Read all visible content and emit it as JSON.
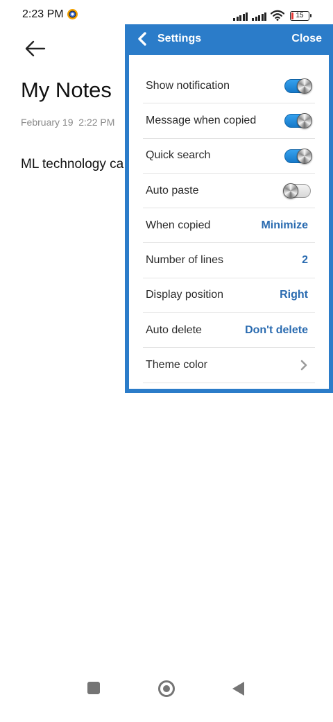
{
  "status_bar": {
    "time": "2:23 PM",
    "battery_level": "15",
    "battery_percent": 15
  },
  "note": {
    "title": "My Notes",
    "date": "February 19  2:22 PM",
    "text": "ML technology ca"
  },
  "settings": {
    "title": "Settings",
    "close_label": "Close",
    "rows": [
      {
        "label": "Show notification",
        "toggle": true
      },
      {
        "label": "Message when copied",
        "toggle": true
      },
      {
        "label": "Quick search",
        "toggle": true
      },
      {
        "label": "Auto paste",
        "toggle": false
      },
      {
        "label": "When copied",
        "value": "Minimize"
      },
      {
        "label": "Number of lines",
        "value": "2"
      },
      {
        "label": "Display position",
        "value": "Right"
      },
      {
        "label": "Auto delete",
        "value": "Don't delete"
      },
      {
        "label": "Theme color",
        "icon": "chevron-right-icon"
      }
    ]
  },
  "colors": {
    "panel_accent": "#2b7cc9",
    "value_text": "#2a6bb0",
    "battery_low": "#e53935"
  },
  "icons": {
    "back": "arrow-left-icon",
    "panel_back": "chevron-left-icon",
    "nav_recents": "square-icon",
    "nav_home": "circle-icon",
    "nav_back": "triangle-left-icon"
  }
}
